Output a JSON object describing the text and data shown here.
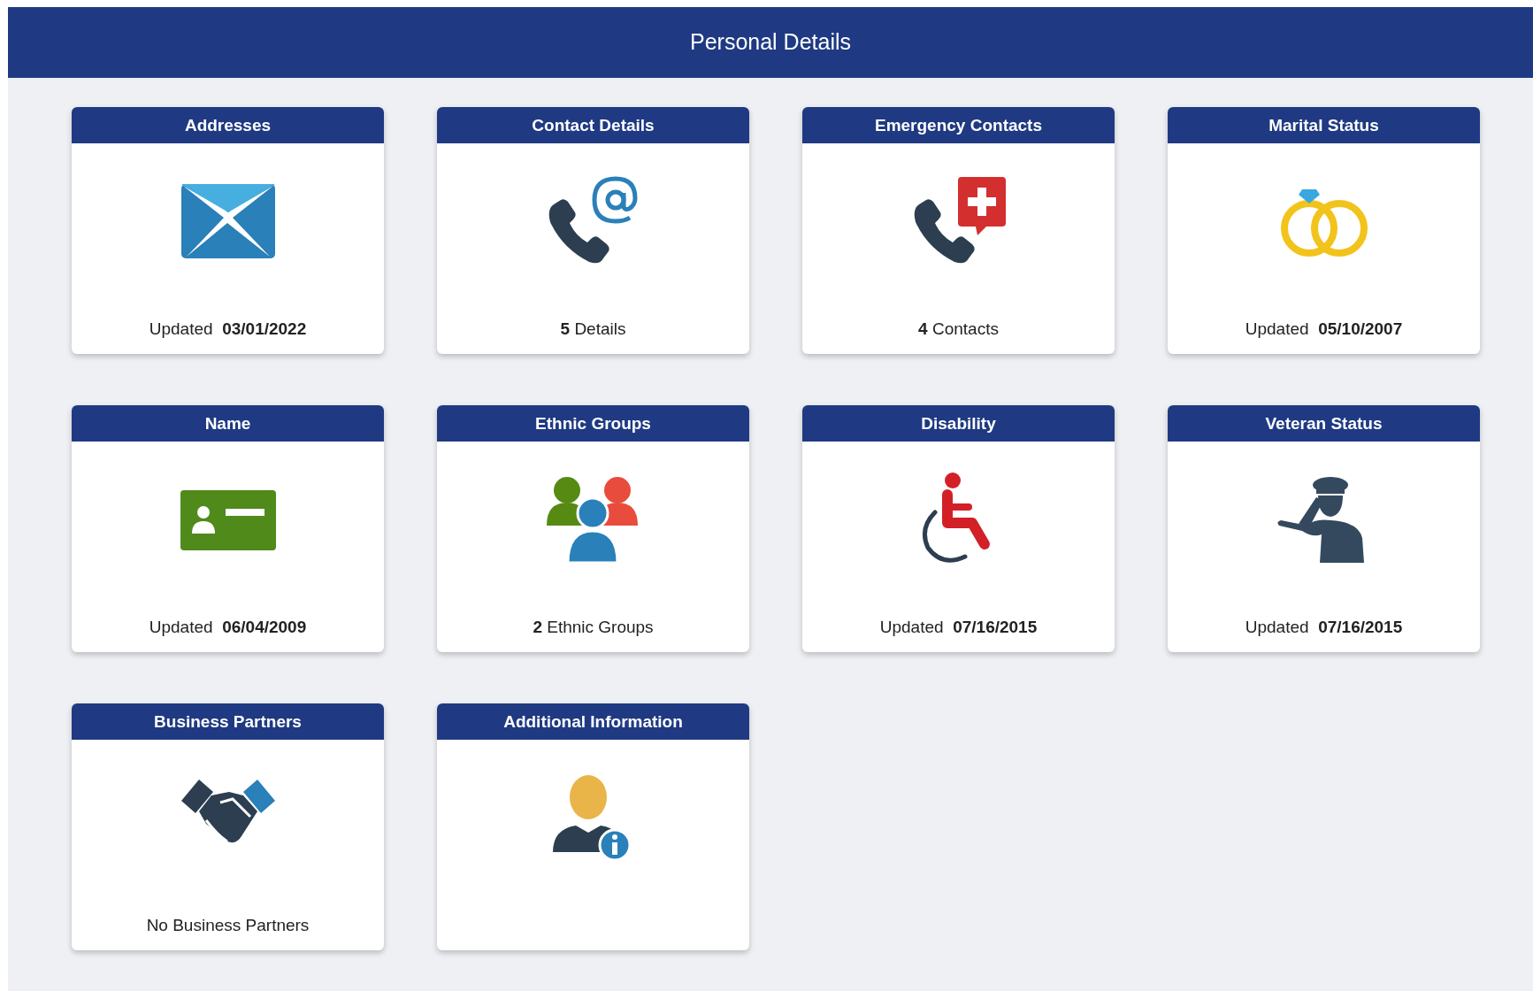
{
  "header": {
    "title": "Personal Details"
  },
  "tiles": [
    {
      "title": "Addresses",
      "footer": "Updated  **03/01/2022**"
    },
    {
      "title": "Contact Details",
      "footer": "**5** Details"
    },
    {
      "title": "Emergency Contacts",
      "footer": "**4** Contacts"
    },
    {
      "title": "Marital Status",
      "footer": "Updated  **05/10/2007**"
    },
    {
      "title": "Name",
      "footer": "Updated  **06/04/2009**"
    },
    {
      "title": "Ethnic Groups",
      "footer": "**2** Ethnic Groups"
    },
    {
      "title": "Disability",
      "footer": "Updated  **07/16/2015**"
    },
    {
      "title": "Veteran Status",
      "footer": "Updated  **07/16/2015**"
    },
    {
      "title": "Business Partners",
      "footer": "No Business Partners"
    },
    {
      "title": "Additional Information"
    }
  ]
}
